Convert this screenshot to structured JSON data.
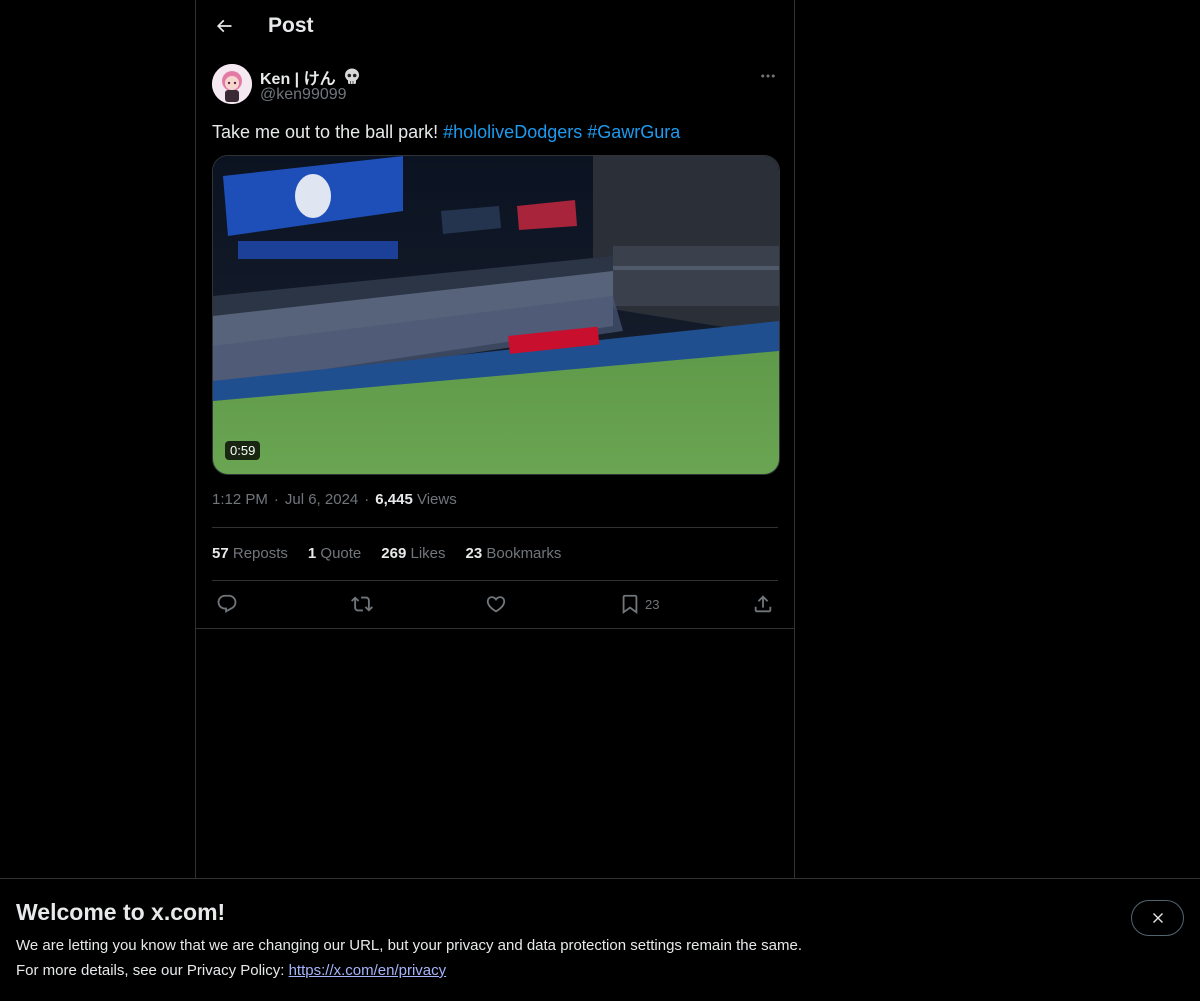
{
  "header": {
    "title": "Post",
    "back_icon": "arrow-left-icon"
  },
  "author": {
    "name": "Ken | けん",
    "handle": "@ken99099",
    "badge_icon": "skull-icon"
  },
  "post": {
    "text_prefix": "Take me out to the ball park! ",
    "hashtags": [
      "#hololiveDodgers",
      "#GawrGura"
    ],
    "video_duration": "0:59",
    "time": "1:12 PM",
    "date": "Jul 6, 2024",
    "views_count": "6,445",
    "views_label": "Views"
  },
  "stats": {
    "reposts_count": "57",
    "reposts_label": "Reposts",
    "quote_count": "1",
    "quote_label": "Quote",
    "likes_count": "269",
    "likes_label": "Likes",
    "bookmarks_count": "23",
    "bookmarks_label": "Bookmarks"
  },
  "actions": {
    "bookmark_count": "23"
  },
  "banner": {
    "title": "Welcome to x.com!",
    "line1": "We are letting you know that we are changing our URL, but your privacy and data protection settings remain the same.",
    "line2_prefix": "For more details, see our Privacy Policy: ",
    "link": "https://x.com/en/privacy"
  },
  "colors": {
    "accent": "#1d9bf0",
    "background": "#000000",
    "muted": "#71767b",
    "text": "#e7e9ea"
  }
}
